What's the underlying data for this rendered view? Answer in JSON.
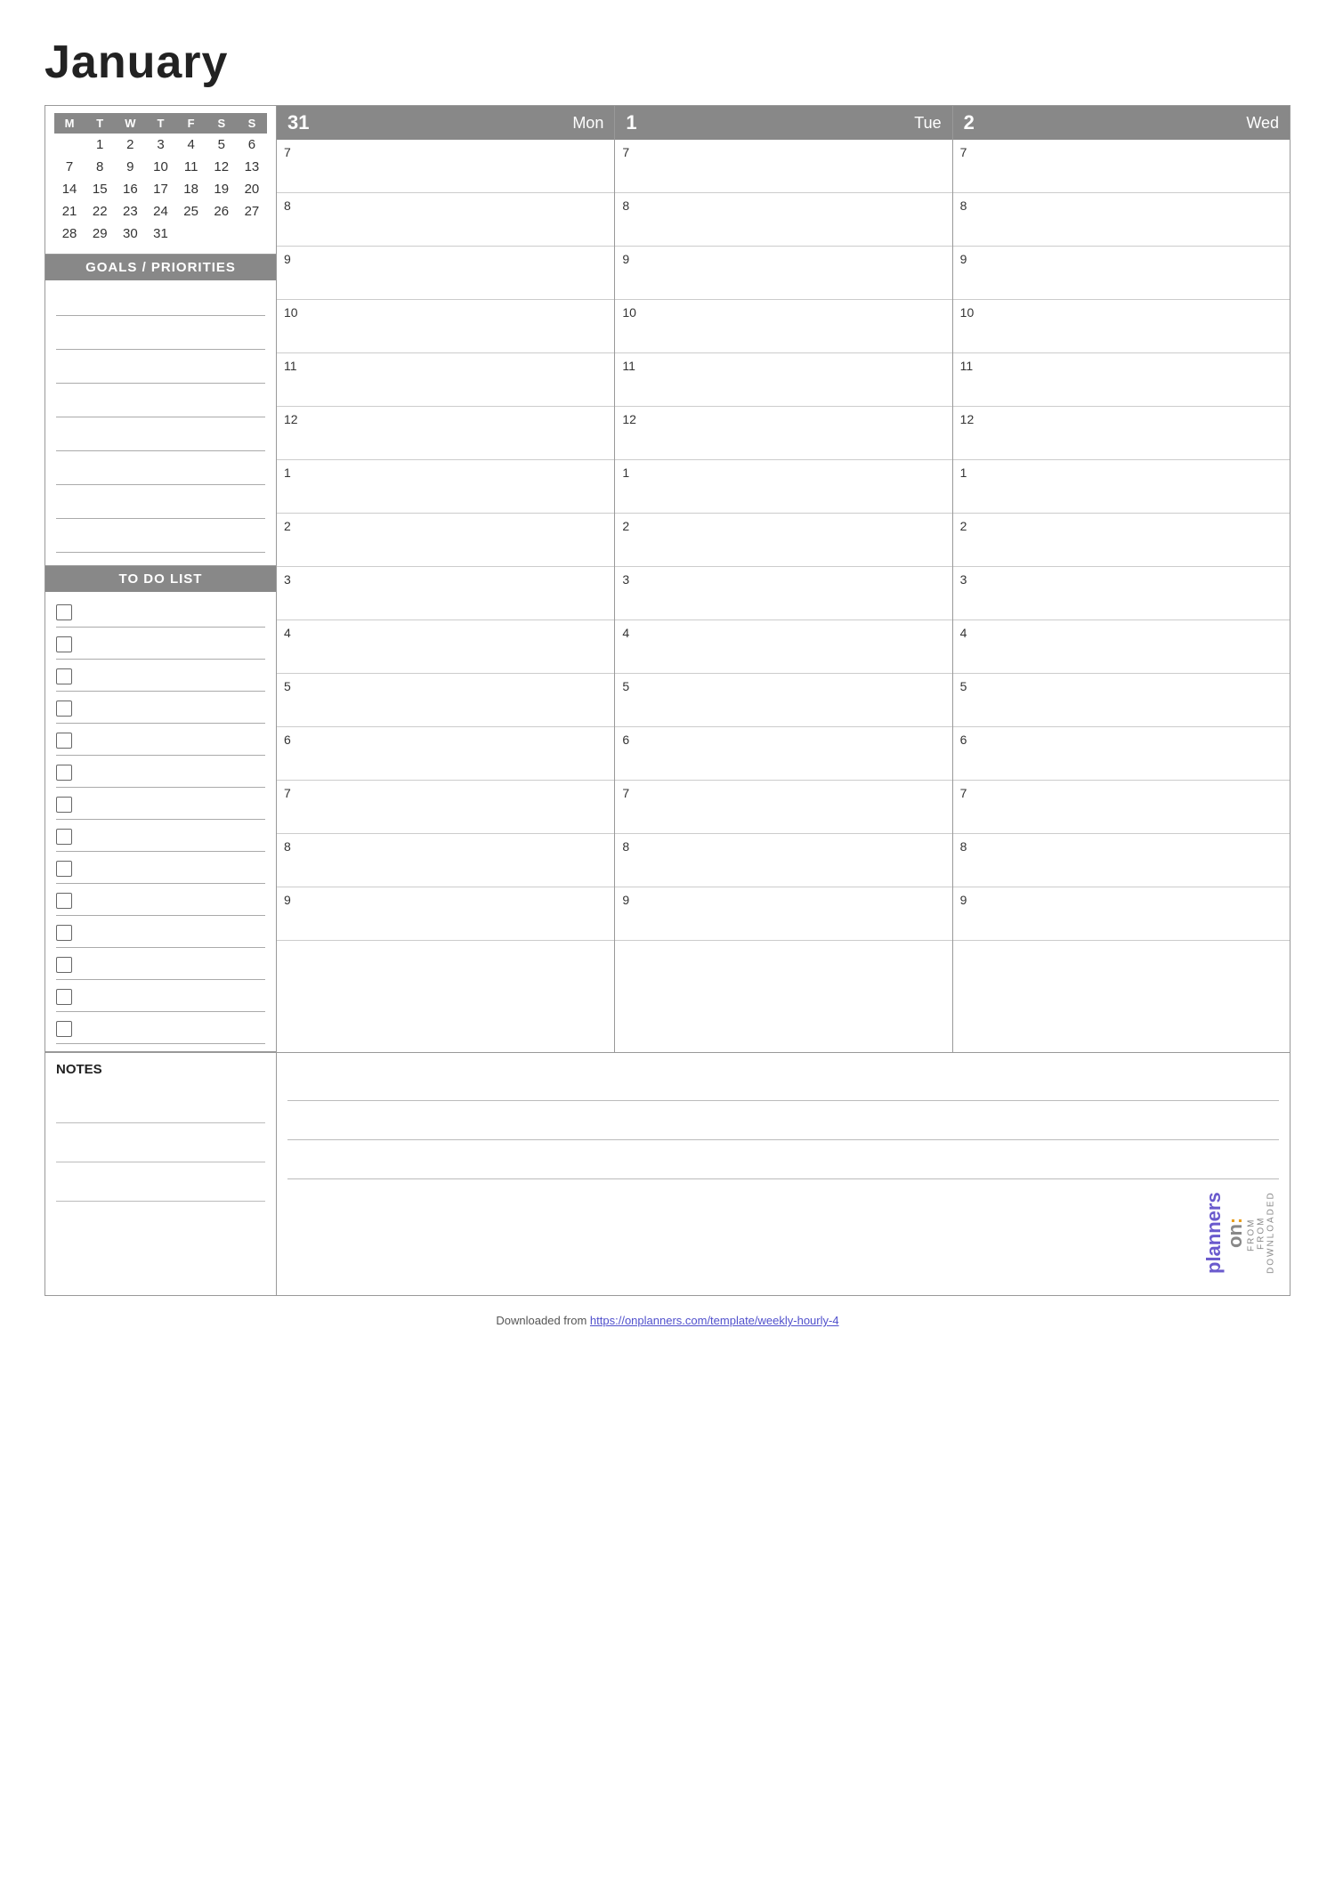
{
  "page": {
    "title": "January"
  },
  "mini_calendar": {
    "headers": [
      "M",
      "T",
      "W",
      "T",
      "F",
      "S",
      "S"
    ],
    "weeks": [
      [
        "",
        "1",
        "2",
        "3",
        "4",
        "5",
        "6"
      ],
      [
        "7",
        "8",
        "9",
        "10",
        "11",
        "12",
        "13"
      ],
      [
        "14",
        "15",
        "16",
        "17",
        "18",
        "19",
        "20"
      ],
      [
        "21",
        "22",
        "23",
        "24",
        "25",
        "26",
        "27"
      ],
      [
        "28",
        "29",
        "30",
        "31",
        "",
        "",
        ""
      ]
    ]
  },
  "goals_header": "GOALS / PRIORITIES",
  "todo_header": "TO DO LIST",
  "notes_label": "NOTES",
  "days": [
    {
      "number": "31",
      "name": "Mon"
    },
    {
      "number": "1",
      "name": "Tue"
    },
    {
      "number": "2",
      "name": "Wed"
    }
  ],
  "hours": [
    "7",
    "8",
    "9",
    "10",
    "11",
    "12",
    "1",
    "2",
    "3",
    "4",
    "5",
    "6",
    "7",
    "8",
    "9"
  ],
  "num_goals": 8,
  "num_todo": 14,
  "num_notes_lines": 3,
  "branding": {
    "downloaded": "DOWNLOADED FROM",
    "on": "on:",
    "planners": "planners"
  },
  "footer": {
    "text": "Downloaded from ",
    "link_text": "https://onplanners.com/template/weekly-hourly-4",
    "link_href": "https://onplanners.com/template/weekly-hourly-4"
  }
}
